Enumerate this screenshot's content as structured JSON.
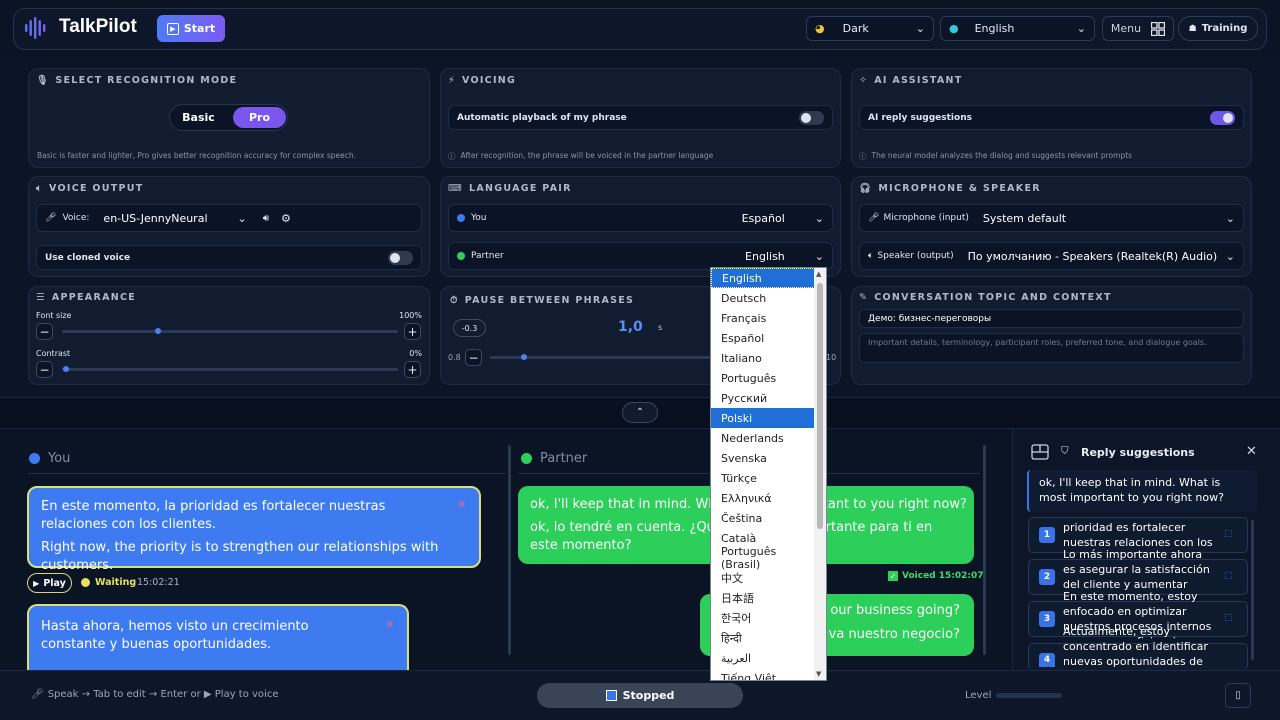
{
  "app": {
    "name": "TalkPilot",
    "start_label": "Start"
  },
  "header": {
    "theme": "Dark",
    "language": "English",
    "menu_label": "Menu",
    "training_label": "Training"
  },
  "recognition": {
    "title": "SELECT RECOGNITION MODE",
    "basic": "Basic",
    "pro": "Pro",
    "hint": "Basic is faster and lighter, Pro gives better recognition accuracy for complex speech."
  },
  "voicing": {
    "title": "VOICING",
    "auto_label": "Automatic playback of my phrase",
    "auto_on": false,
    "hint": "After recognition, the phrase will be voiced in the partner language"
  },
  "ai": {
    "title": "AI ASSISTANT",
    "suggest_label": "AI reply suggestions",
    "suggest_on": true,
    "hint": "The neural model analyzes the dialog and suggests relevant prompts"
  },
  "voice_output": {
    "title": "VOICE OUTPUT",
    "voice_label": "Voice:",
    "voice_value": "en-US-JennyNeural",
    "cloned_label": "Use cloned voice",
    "cloned_on": false
  },
  "language_pair": {
    "title": "LANGUAGE PAIR",
    "you_label": "You",
    "you_value": "Español",
    "partner_label": "Partner",
    "partner_value": "English"
  },
  "mic_speaker": {
    "title": "MICROPHONE & SPEAKER",
    "mic_label": "Microphone (input)",
    "mic_value": "System default",
    "spk_label": "Speaker (output)",
    "spk_value": "По умолчанию - Speakers (Realtek(R) Audio)"
  },
  "appearance": {
    "title": "APPEARANCE",
    "font_label": "Font size",
    "font_value": "100%",
    "font_level": 0.28,
    "contrast_label": "Contrast",
    "contrast_value": "0%",
    "contrast_level": 0.0,
    "minus": "−",
    "plus": "+"
  },
  "pause": {
    "title": "PAUSE BETWEEN PHRASES",
    "delta": "-0.3",
    "value": "1,0",
    "unit": "s",
    "min": "0.8",
    "max": "10",
    "minus": "−"
  },
  "topic": {
    "title": "CONVERSATION TOPIC AND CONTEXT",
    "value": "Демо: бизнес-переговоры",
    "placeholder": "Important details, terminology, participant roles, preferred tone, and dialogue goals."
  },
  "conversation": {
    "you_head": "You",
    "partner_head": "Partner",
    "you_msg1_a": "En este momento, la prioridad es fortalecer nuestras relaciones con los clientes.",
    "you_msg1_b": "Right now, the priority is to strengthen our relationships with customers.",
    "play_label": "Play",
    "waiting_label": "Waiting",
    "you_msg1_time": "15:02:21",
    "you_msg2_a": "Hasta ahora, hemos visto un crecimiento constante y buenas oportunidades.",
    "partner_msg1_a": "ok, I'll keep that in mind. What is most important to you right now?",
    "partner_msg1_b": "ok, lo tendré en cuenta. ¿Qué es lo más importante para ti en este momento?",
    "partner_voiced": "Voiced 15:02:07",
    "partner_msg2_a": "is our business going?",
    "partner_msg2_b": "o va nuestro negocio?"
  },
  "suggestions": {
    "title": "Reply suggestions",
    "quote": "ok, I'll keep that in mind. What is most important to you right now?",
    "items": [
      {
        "num": "1",
        "text": "prioridad es fortalecer nuestras relaciones con los"
      },
      {
        "num": "2",
        "text": "Lo más importante ahora es asegurar la satisfacción del cliente y aumentar nuestras"
      },
      {
        "num": "3",
        "text": "En este momento, estoy enfocado en optimizar nuestros procesos internos para mayor eficiencia"
      },
      {
        "num": "4",
        "text": "Actualmente, estoy concentrado en identificar nuevas oportunidades de"
      }
    ]
  },
  "bottom": {
    "hint": "Speak → Tab to edit → Enter or ▶ Play to voice",
    "status": "Stopped",
    "level_label": "Level"
  },
  "dropdown": {
    "options": [
      "English",
      "Deutsch",
      "Français",
      "Español",
      "Italiano",
      "Português",
      "Русский",
      "Polski",
      "Nederlands",
      "Svenska",
      "Türkçe",
      "Ελληνικά",
      "Čeština",
      "Català",
      "Português (Brasil)",
      "中文",
      "日本語",
      "한국어",
      "हिन्दी",
      "العربية",
      "Tiếng Việt"
    ],
    "selected": "English",
    "highlighted": "Polski"
  },
  "colors": {
    "accent": "#7a55ee",
    "you_bubble": "#3e7bf0",
    "partner_bubble": "#2ccf5a",
    "waiting": "#e6e25a"
  }
}
